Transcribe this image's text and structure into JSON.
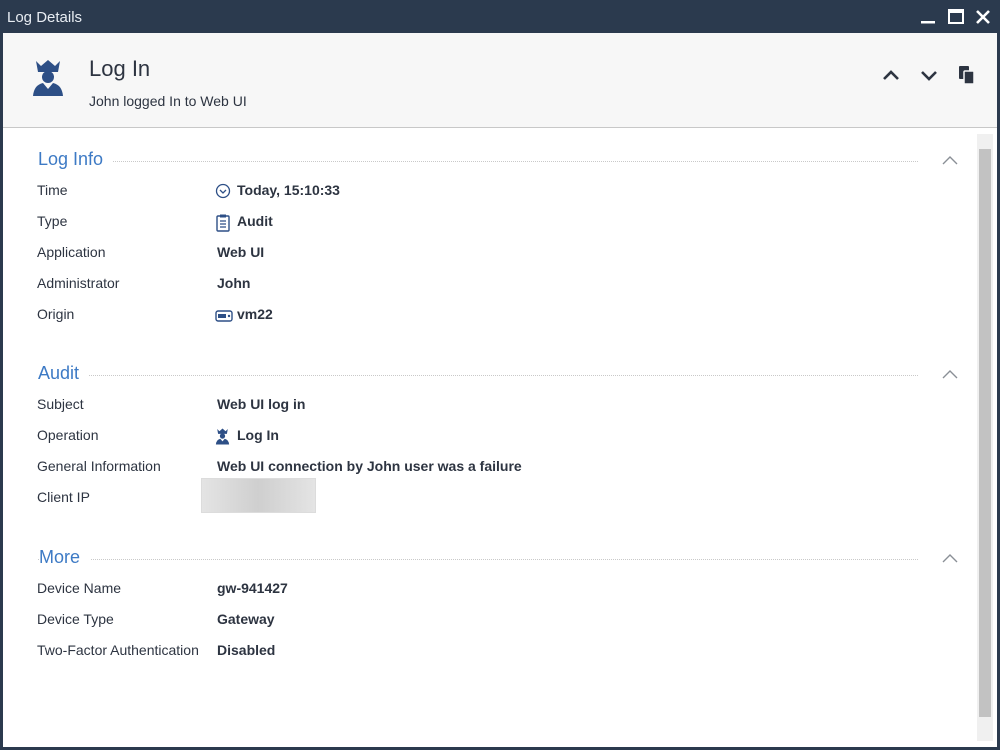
{
  "window": {
    "title": "Log Details",
    "icons": {
      "minimize": "minimize-icon",
      "maximize": "maximize-icon",
      "close": "close-icon"
    }
  },
  "header": {
    "title": "Log In",
    "subtitle": "John logged In to Web UI",
    "icon": "administrator-icon",
    "actions": [
      "previous-icon",
      "next-icon",
      "copy-icon"
    ]
  },
  "sections": {
    "log_info": {
      "title": "Log Info",
      "rows": {
        "time": {
          "label": "Time",
          "value": "Today, 15:10:33",
          "icon": "clock-icon"
        },
        "type": {
          "label": "Type",
          "value": "Audit",
          "icon": "clipboard-icon"
        },
        "application": {
          "label": "Application",
          "value": "Web UI"
        },
        "administrator": {
          "label": "Administrator",
          "value": "John"
        },
        "origin": {
          "label": "Origin",
          "value": "vm22",
          "icon": "device-icon"
        }
      }
    },
    "audit": {
      "title": "Audit",
      "rows": {
        "subject": {
          "label": "Subject",
          "value": "Web UI log in"
        },
        "operation": {
          "label": "Operation",
          "value": "Log In",
          "icon": "administrator-icon"
        },
        "general_information": {
          "label": "General Information",
          "value": "Web UI connection by John user was a failure"
        },
        "client_ip": {
          "label": "Client IP",
          "value": ""
        }
      }
    },
    "more": {
      "title": "More",
      "rows": {
        "device_name": {
          "label": "Device Name",
          "value": "gw-941427"
        },
        "device_type": {
          "label": "Device Type",
          "value": "Gateway"
        },
        "two_factor": {
          "label": "Two-Factor Authentication",
          "value": "Disabled"
        }
      }
    }
  },
  "colors": {
    "titlebar": "#2b3a4e",
    "accent": "#3d7ac5",
    "text": "#2d3441",
    "icon": "#2d4f86"
  }
}
